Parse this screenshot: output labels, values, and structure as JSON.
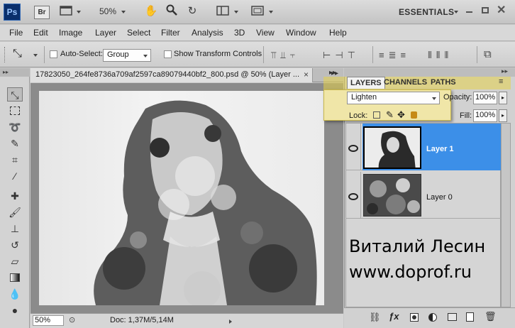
{
  "appbar": {
    "ps_logo": "Ps",
    "br_logo": "Br",
    "zoom": "50%",
    "workspace": "ESSENTIALS"
  },
  "menu": [
    "File",
    "Edit",
    "Image",
    "Layer",
    "Select",
    "Filter",
    "Analysis",
    "3D",
    "View",
    "Window",
    "Help"
  ],
  "options": {
    "auto_select_label": "Auto-Select:",
    "auto_select_value": "Group",
    "show_transform_label": "Show Transform Controls"
  },
  "document": {
    "tab_title": "17823050_264fe8736a709af2597ca89079440bf2_800.psd @ 50% (Layer ...",
    "zoom": "50%",
    "doc_size": "Doc: 1,37M/5,14M"
  },
  "panel": {
    "tabs": [
      "LAYERS",
      "CHANNELS",
      "PATHS"
    ],
    "blend_mode": "Lighten",
    "opacity_label": "Opacity:",
    "opacity_value": "100%",
    "lock_label": "Lock:",
    "fill_label": "Fill:",
    "fill_value": "100%",
    "layers": [
      {
        "name": "Layer 1",
        "selected": true
      },
      {
        "name": "Layer 0",
        "selected": false
      }
    ]
  },
  "watermark": {
    "line1": "Виталий Лесин",
    "line2": "www.doprof.ru"
  },
  "colors": {
    "selection_blue": "#3c8fe8",
    "panel_bg": "#d1d1d1"
  }
}
